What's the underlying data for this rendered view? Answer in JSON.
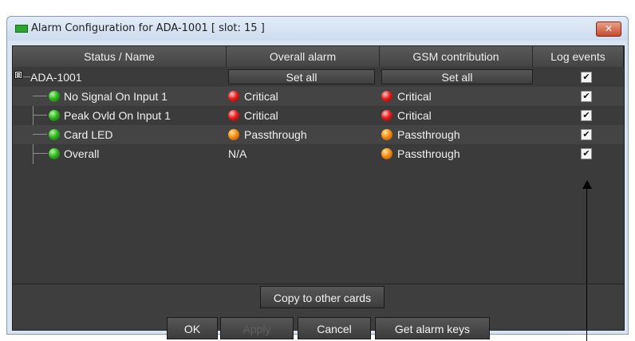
{
  "window": {
    "title": "Alarm Configuration for ADA-1001 [ slot: 15 ]",
    "close_icon": "close-icon",
    "close_glyph": "✕"
  },
  "table": {
    "headers": [
      "Status / Name",
      "Overall alarm",
      "GSM contribution",
      "Log events"
    ],
    "parent": {
      "name": "ADA-1001",
      "expander": "⊟",
      "set_all_overall": "Set all",
      "set_all_gsm": "Set all",
      "log_checked": true
    },
    "rows": [
      {
        "name": "No Signal On Input 1",
        "status_led": "green",
        "overall_led": "red",
        "overall": "Critical",
        "gsm_led": "red",
        "gsm": "Critical",
        "log_checked": true
      },
      {
        "name": "Peak Ovld On Input 1",
        "status_led": "green",
        "overall_led": "red",
        "overall": "Critical",
        "gsm_led": "red",
        "gsm": "Critical",
        "log_checked": true
      },
      {
        "name": "Card LED",
        "status_led": "green",
        "overall_led": "orange",
        "overall": "Passthrough",
        "gsm_led": "orange",
        "gsm": "Passthrough",
        "log_checked": true
      },
      {
        "name": "Overall",
        "status_led": "green",
        "overall_led": null,
        "overall": "N/A",
        "gsm_led": "orange",
        "gsm": "Passthrough",
        "log_checked": true
      }
    ]
  },
  "actions": {
    "copy": "Copy to other cards",
    "ok": "OK",
    "apply": "Apply",
    "cancel": "Cancel",
    "alarm_keys": "Get alarm keys"
  },
  "check_glyph": "✔",
  "colors": {
    "led_green": "#31b61f",
    "led_red": "#e31e1e",
    "led_orange": "#f28e16",
    "panel_bg": "#3b3b3b",
    "title_bar": "#d9e4f1"
  }
}
